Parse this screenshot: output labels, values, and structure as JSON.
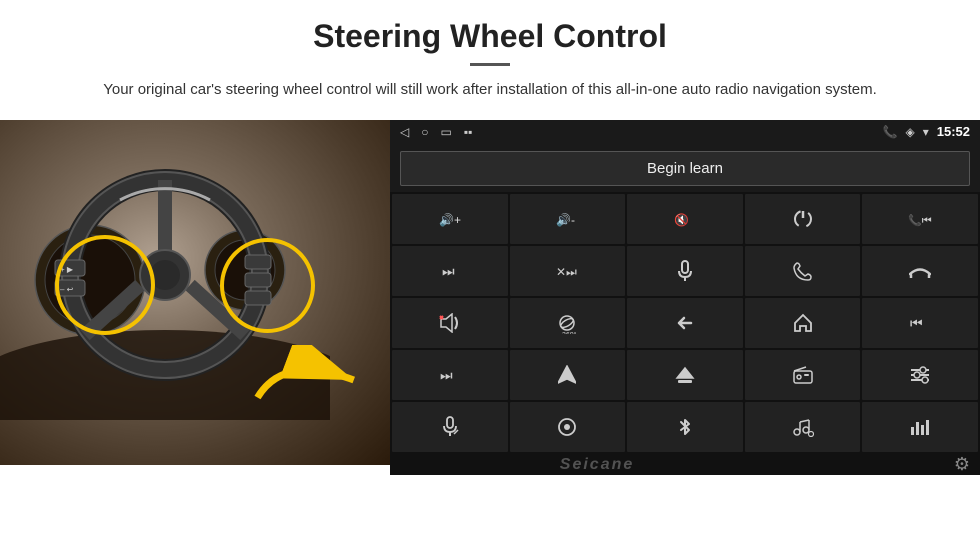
{
  "header": {
    "title": "Steering Wheel Control",
    "subtitle": "Your original car's steering wheel control will still work after installation of this all-in-one auto radio navigation system."
  },
  "status_bar": {
    "time": "15:52",
    "icons_left": [
      "back-arrow",
      "home-circle",
      "square-recent"
    ],
    "icons_right": [
      "phone-icon",
      "location-icon",
      "wifi-icon",
      "battery-icon"
    ]
  },
  "begin_learn": {
    "label": "Begin learn"
  },
  "control_grid": {
    "rows": [
      [
        "🔊+",
        "🔊—",
        "🔊✕",
        "⏻",
        "📞⏮"
      ],
      [
        "⏭|",
        "✕⏭",
        "🎤",
        "📞",
        "☎"
      ],
      [
        "📢",
        "🔄",
        "↩",
        "🏠",
        "⏮⏮"
      ],
      [
        "⏭⏭",
        "▶",
        "⏏",
        "📻",
        "⚙"
      ],
      [
        "🎤",
        "⊙",
        "✳",
        "🎵",
        "📶"
      ]
    ],
    "icons": [
      "vol-up",
      "vol-down",
      "vol-mute",
      "power",
      "call-prev",
      "next-track",
      "fast-forward",
      "microphone",
      "phone-call",
      "hang-up",
      "speaker",
      "surround-360",
      "back-arrow",
      "home",
      "prev-track",
      "fast-forward-2",
      "navigate",
      "eject",
      "radio",
      "settings-sliders",
      "mic-2",
      "circle-dot",
      "bluetooth",
      "music-settings",
      "equalizer"
    ]
  },
  "seicane": {
    "logo": "Seicane"
  }
}
